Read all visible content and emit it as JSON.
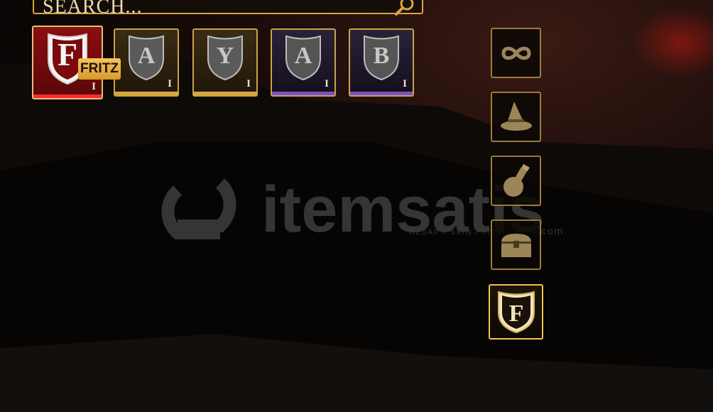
{
  "search": {
    "placeholder": "SEARCH..."
  },
  "characters": [
    {
      "letter": "F",
      "rank": "I",
      "rarity": "red",
      "selected": true,
      "name": "FRITZ"
    },
    {
      "letter": "A",
      "rank": "I",
      "rarity": "gold"
    },
    {
      "letter": "Y",
      "rank": "I",
      "rarity": "gold"
    },
    {
      "letter": "A",
      "rank": "I",
      "rarity": "purple"
    },
    {
      "letter": "B",
      "rank": "I",
      "rarity": "purple"
    }
  ],
  "sidebar": {
    "buttons": [
      {
        "icon": "infinity-icon"
      },
      {
        "icon": "wizard-hat-icon"
      },
      {
        "icon": "potion-icon"
      },
      {
        "icon": "treasure-chest-icon"
      },
      {
        "icon": "shield-f-icon",
        "letter": "F",
        "active": true
      }
    ]
  },
  "watermark": {
    "brand": "itemsatis",
    "sub": "HESAP / SKIN / ITEM / E-PIN",
    "suffix": ".com"
  },
  "colors": {
    "gold": "#d8a73a",
    "purple": "#7c50c8",
    "red": "#ff2a2a",
    "badge": "#f6c25a"
  }
}
